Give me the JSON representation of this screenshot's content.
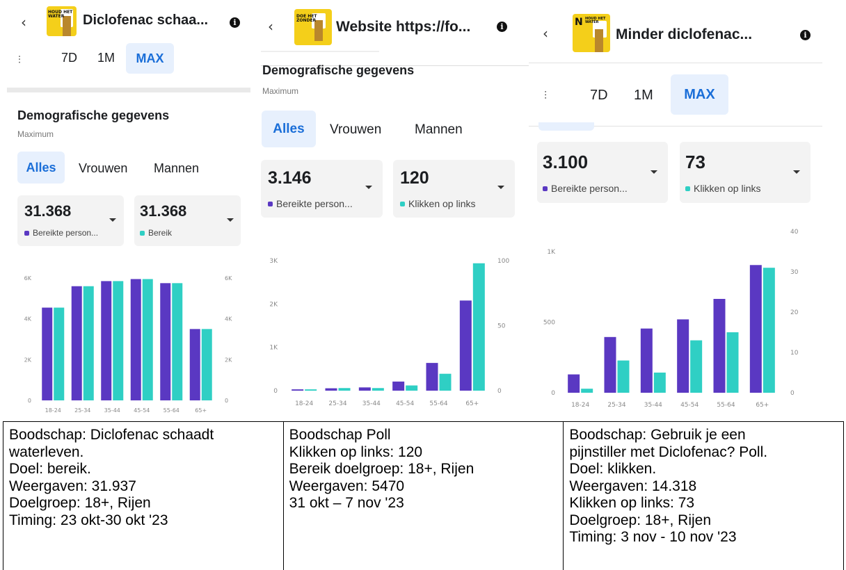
{
  "panels": [
    {
      "title": "Diclofenac schaa...",
      "thumb_text": "HOUD HET WATER",
      "filters": [
        "7D",
        "1M",
        "MAX"
      ],
      "filter_active": "MAX",
      "section_title": "Demografische gegevens",
      "section_sub": "Maximum",
      "tabs": [
        "Alles",
        "Vrouwen",
        "Mannen"
      ],
      "tab_active": "Alles",
      "metrics": [
        {
          "value": "31.368",
          "label": "Bereikte person...",
          "color": "#5a38c2"
        },
        {
          "value": "31.368",
          "label": "Bereik",
          "color": "#2fcfc4"
        }
      ]
    },
    {
      "title": "Website https://fo...",
      "thumb_text": "DOE HET ZONDER",
      "filters": [],
      "section_title": "Demografische gegevens",
      "section_sub": "Maximum",
      "tabs": [
        "Alles",
        "Vrouwen",
        "Mannen"
      ],
      "tab_active": "Alles",
      "metrics": [
        {
          "value": "3.146",
          "label": "Bereikte person...",
          "color": "#5a38c2"
        },
        {
          "value": "120",
          "label": "Klikken op links",
          "color": "#2fcfc4"
        }
      ]
    },
    {
      "title": "Minder diclofenac...",
      "thumb_text": "HOUD HET WATER",
      "filters": [
        "7D",
        "1M",
        "MAX"
      ],
      "filter_active": "MAX",
      "metrics": [
        {
          "value": "3.100",
          "label": "Bereikte person...",
          "color": "#5a38c2"
        },
        {
          "value": "73",
          "label": "Klikken op links",
          "color": "#2fcfc4"
        }
      ]
    }
  ],
  "chart_data": [
    {
      "type": "bar",
      "categories": [
        "18-24",
        "25-34",
        "35-44",
        "45-54",
        "55-64",
        "65+"
      ],
      "series": [
        {
          "name": "Bereikte person...",
          "values": [
            4550,
            5600,
            5850,
            5950,
            5750,
            3500
          ],
          "axis": "left"
        },
        {
          "name": "Bereik",
          "values": [
            4550,
            5600,
            5850,
            5950,
            5750,
            3500
          ],
          "axis": "right"
        }
      ],
      "left_ticks": [
        "0",
        "2K",
        "4K",
        "6K"
      ],
      "right_ticks": [
        "0",
        "2K",
        "4K",
        "6K"
      ],
      "ylim_left": [
        0,
        6000
      ],
      "ylim_right": [
        0,
        6000
      ],
      "colors": [
        "#5a38c2",
        "#2fcfc4"
      ]
    },
    {
      "type": "bar",
      "categories": [
        "18-24",
        "25-34",
        "35-44",
        "45-54",
        "55-64",
        "65+"
      ],
      "series": [
        {
          "name": "Bereikte person...",
          "values": [
            30,
            55,
            75,
            210,
            640,
            2080
          ],
          "axis": "left"
        },
        {
          "name": "Klikken op links",
          "values": [
            1,
            2,
            2,
            4,
            13,
            98
          ],
          "axis": "right"
        }
      ],
      "left_ticks": [
        "0",
        "1K",
        "2K",
        "3K"
      ],
      "right_ticks": [
        "0",
        "50",
        "100"
      ],
      "ylim_left": [
        0,
        3000
      ],
      "ylim_right": [
        0,
        100
      ],
      "colors": [
        "#5a38c2",
        "#2fcfc4"
      ]
    },
    {
      "type": "bar",
      "categories": [
        "18-24",
        "25-34",
        "35-44",
        "45-54",
        "55-64",
        "65+"
      ],
      "series": [
        {
          "name": "Bereikte person...",
          "values": [
            130,
            395,
            455,
            520,
            665,
            905
          ],
          "axis": "left"
        },
        {
          "name": "Klikken op links",
          "values": [
            1,
            8,
            5,
            13,
            15,
            31
          ],
          "axis": "right"
        }
      ],
      "left_ticks": [
        "0",
        "500",
        "1K"
      ],
      "right_ticks": [
        "0",
        "10",
        "20",
        "30",
        "40"
      ],
      "ylim_left": [
        0,
        1000
      ],
      "ylim_right": [
        0,
        35
      ],
      "colors": [
        "#5a38c2",
        "#2fcfc4"
      ]
    }
  ],
  "notes": [
    [
      "Boodschap: Diclofenac schaadt",
      "waterleven.",
      "Doel: bereik.",
      "Weergaven: 31.937",
      "Doelgroep: 18+, Rijen",
      "Timing: 23 okt-30 okt '23"
    ],
    [
      "Boodschap Poll",
      "Klikken op links: 120",
      "Bereik doelgroep: 18+, Rijen",
      "Weergaven: 5470",
      "31 okt – 7 nov '23"
    ],
    [
      "Boodschap: Gebruik je een",
      "pijnstiller met Diclofenac? Poll.",
      "Doel: klikken.",
      "Weergaven: 14.318",
      "Klikken op links: 73",
      "Doelgroep: 18+, Rijen",
      "Timing: 3 nov - 10 nov '23"
    ]
  ]
}
